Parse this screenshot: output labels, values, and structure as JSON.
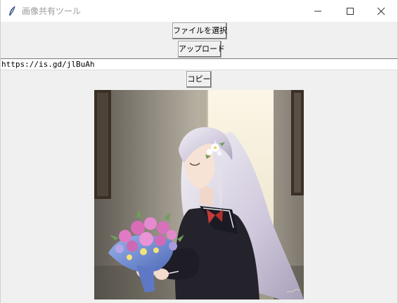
{
  "window": {
    "title": "画像共有ツール",
    "controls": [
      "minimize-icon",
      "maximize-icon",
      "close-icon"
    ]
  },
  "buttons": {
    "select_file": "ファイルを選択",
    "upload": "アップロード",
    "copy": "コピー"
  },
  "url_field": {
    "value": "https://is.gd/jlBuAh"
  },
  "preview": {
    "icon": "image-preview",
    "colors": {
      "background_wall": "#8f8a80",
      "window_light": "#f3ecd8",
      "hair": "#dcd8e8",
      "uniform": "#24232b",
      "bouquet_pink": "#e07ac4",
      "bouquet_wrap": "#6f8fd8"
    }
  }
}
